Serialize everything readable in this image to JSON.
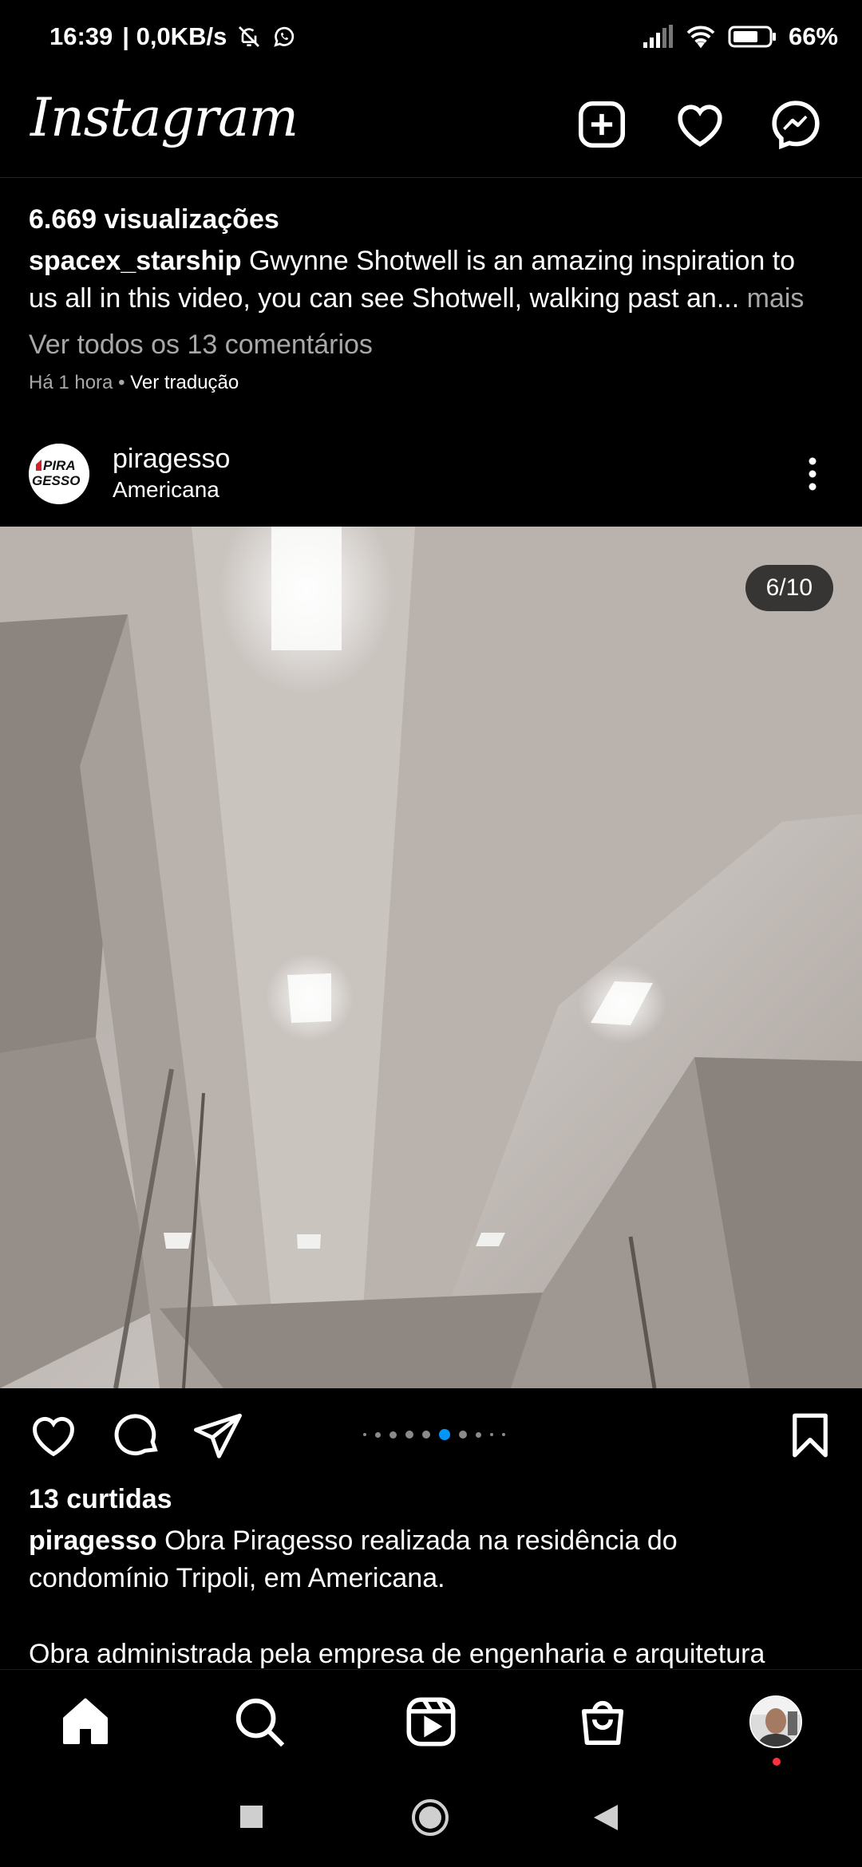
{
  "status_bar": {
    "time": "16:39",
    "network_speed": "| 0,0KB/s",
    "battery": "66%",
    "icons": [
      "mute-bell-icon",
      "whatsapp-icon",
      "signal-icon",
      "wifi-icon",
      "battery-icon"
    ]
  },
  "header": {
    "logo": "Instagram",
    "icons": [
      "new-post-icon",
      "activity-heart-icon",
      "messenger-icon"
    ]
  },
  "previous_post": {
    "views": "6.669 visualizações",
    "caption_user": "spacex_starship",
    "caption_line1": " Gwynne Shotwell is an amazing inspiration to",
    "caption_line2": "us all in this video, you can see Shotwell, walking past an...",
    "more": " mais",
    "comments_link": "Ver todos os 13 comentários",
    "time_ago": "Há 1 hora",
    "separator": " • ",
    "translate": "Ver tradução"
  },
  "post": {
    "username": "piragesso",
    "location": "Americana",
    "avatar_text_1": "PIRA",
    "avatar_text_2": "GESSO",
    "carousel_counter": "6/10",
    "carousel_total": 10,
    "carousel_active": 6,
    "likes": "13 curtidas",
    "caption_user": "piragesso",
    "caption_line1": " Obra Piragesso realizada na residência do",
    "caption_line2": "condomínio Tripoli, em Americana.",
    "caption_line3": "Obra administrada pela empresa de engenharia e arquitetura"
  },
  "colors": {
    "background": "#000000",
    "muted_text": "#a8a8a8",
    "active_dot": "#0095f6",
    "notification_dot": "#ff3040"
  },
  "bottom_nav": [
    "home-icon",
    "search-icon",
    "reels-icon",
    "shop-icon",
    "profile-avatar"
  ]
}
